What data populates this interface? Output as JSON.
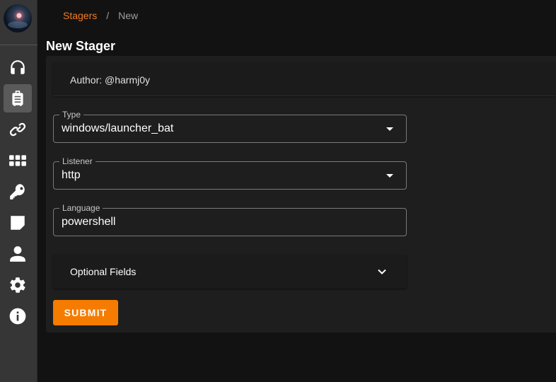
{
  "breadcrumb": {
    "link": "Stagers",
    "separator": "/",
    "current": "New"
  },
  "page": {
    "title": "New Stager"
  },
  "author": "Author: @harmj0y",
  "form": {
    "type": {
      "label": "Type",
      "value": "windows/launcher_bat"
    },
    "listener": {
      "label": "Listener",
      "value": "http"
    },
    "language": {
      "label": "Language",
      "value": "powershell"
    },
    "optional_label": "Optional Fields",
    "submit_label": "SUBMIT"
  },
  "sidebar": {
    "items": [
      {
        "icon": "headphones-icon",
        "active": false
      },
      {
        "icon": "suitcase-icon",
        "active": true
      },
      {
        "icon": "link-icon",
        "active": false
      },
      {
        "icon": "grid-icon",
        "active": false
      },
      {
        "icon": "key-icon",
        "active": false
      },
      {
        "icon": "sticky-note-icon",
        "active": false
      },
      {
        "icon": "user-icon",
        "active": false
      },
      {
        "icon": "gear-icon",
        "active": false
      },
      {
        "icon": "info-icon",
        "active": false
      }
    ]
  },
  "colors": {
    "accent": "#f57c00",
    "link": "#f47c20",
    "background": "#121212",
    "sidebar": "#363636"
  }
}
